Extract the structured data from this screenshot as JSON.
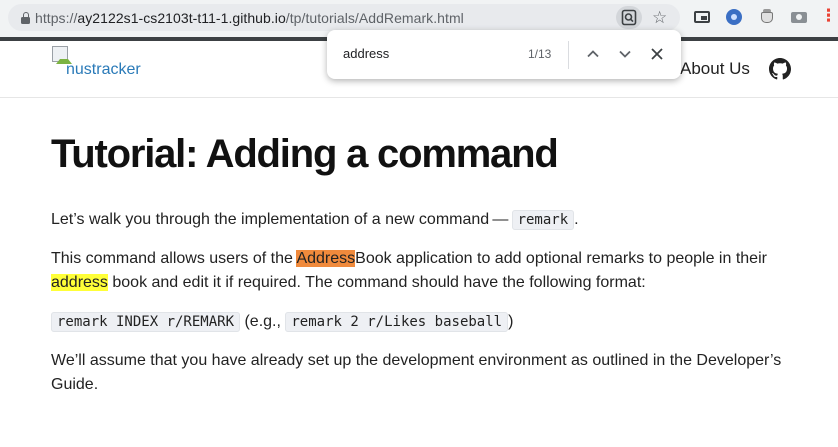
{
  "browser": {
    "url_prefix": "https://",
    "url_host": "ay2122s1-cs2103t-t11-1.github.io",
    "url_path": "/tp/tutorials/AddRemark.html",
    "icons": [
      "lock-icon",
      "find-in-page-icon",
      "bookmark-star-icon",
      "picture-in-picture-icon",
      "extension-icon",
      "extension-icon",
      "screenshot-icon",
      "extension-icon"
    ],
    "star_glyph": "☆",
    "menu_glyph": "⋮"
  },
  "findbar": {
    "query": "address",
    "count": "1/13",
    "icons": [
      "chevron-up-icon",
      "chevron-down-icon",
      "close-icon"
    ]
  },
  "navbar": {
    "logo_alt": "nustracker",
    "about_link": "About Us",
    "github_icon": "github-icon"
  },
  "article": {
    "title": "Tutorial: Adding a command",
    "p1_text": "Let’s walk you through the implementation of a new command — ",
    "p1_code": "remark",
    "p1_end": ".",
    "p2_before": "This command allows users of the ",
    "p2_match1": "Address",
    "p2_middle": "Book application to add optional remarks to people in their ",
    "p2_match2": "address",
    "p2_after": " book and edit it if required. The command should have the following format:",
    "p3_code1": "remark INDEX r/REMARK",
    "p3_mid": " (e.g., ",
    "p3_code2": "remark 2 r/Likes baseball",
    "p3_end": ")",
    "p4_text": "We’ll assume that you have already set up the development environment as outlined in the Developer’s Guide."
  },
  "colors": {
    "find_current_match": "#f08a3c",
    "find_other_match": "#ffff38",
    "chrome_bg": "#f1f3f4",
    "code_bg": "#eef0f4"
  }
}
